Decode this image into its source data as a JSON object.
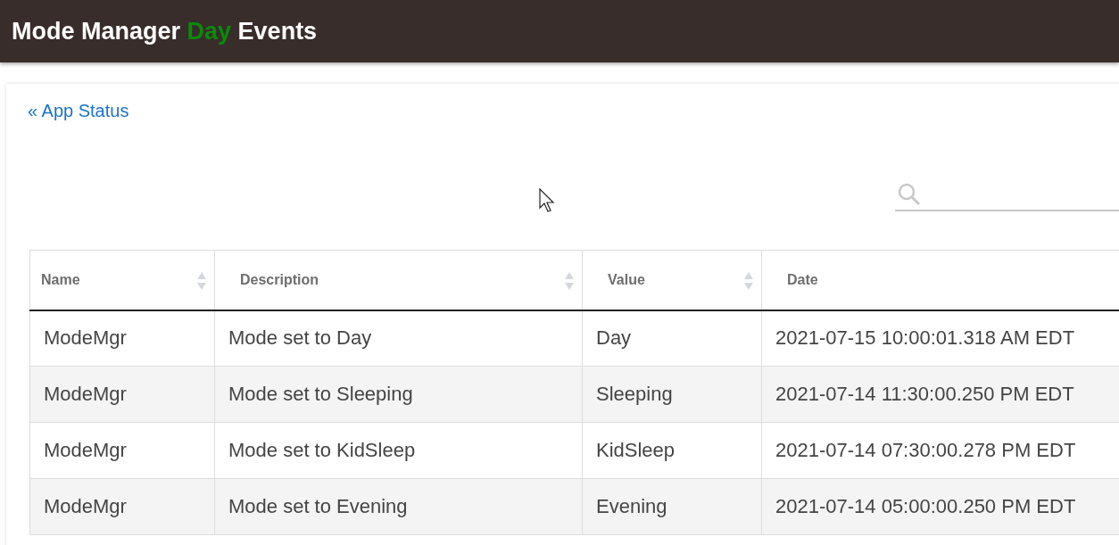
{
  "title": {
    "before": "Mode Manager",
    "highlight": "Day",
    "after": "Events"
  },
  "back_link": "« App Status",
  "table": {
    "columns": [
      "Name",
      "Description",
      "Value",
      "Date"
    ],
    "rows": [
      {
        "cells": [
          "ModeMgr",
          "Mode set to Day",
          "Day",
          "2021-07-15 10:00:01.318 AM EDT"
        ]
      },
      {
        "cells": [
          "ModeMgr",
          "Mode set to Sleeping",
          "Sleeping",
          "2021-07-14 11:30:00.250 PM EDT"
        ]
      },
      {
        "cells": [
          "ModeMgr",
          "Mode set to KidSleep",
          "KidSleep",
          "2021-07-14 07:30:00.278 PM EDT"
        ]
      },
      {
        "cells": [
          "ModeMgr",
          "Mode set to Evening",
          "Evening",
          "2021-07-14 05:00:00.250 PM EDT"
        ]
      }
    ]
  }
}
